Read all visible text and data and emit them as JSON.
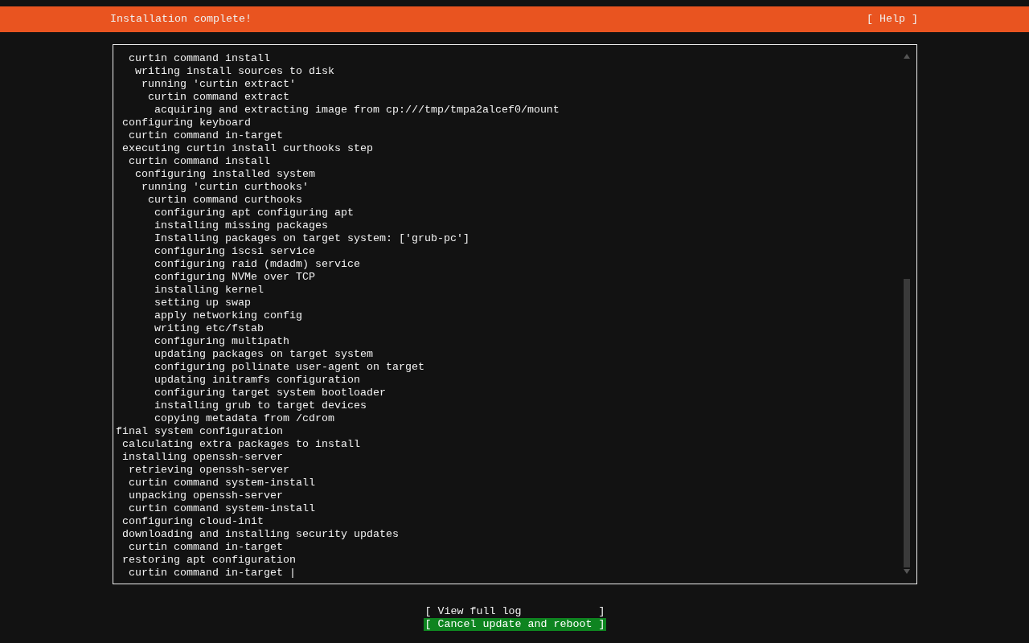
{
  "header": {
    "title": "Installation complete!",
    "help_button": "[ Help ]"
  },
  "log": [
    {
      "children": [
        {
          "children": [
            {
              "text": "curtin command install",
              "children": [
                {
                  "text": "writing install sources to disk",
                  "children": [
                    {
                      "text": "running 'curtin extract'",
                      "children": [
                        {
                          "text": "curtin command extract",
                          "children": [
                            {
                              "text": "acquiring and extracting image from cp:///tmp/tmpa2alcef0/mount"
                            }
                          ]
                        }
                      ]
                    }
                  ]
                }
              ]
            }
          ]
        },
        {
          "text": "configuring keyboard",
          "children": [
            {
              "text": "curtin command in-target"
            }
          ]
        },
        {
          "text": "executing curtin install curthooks step",
          "children": [
            {
              "text": "curtin command install",
              "children": [
                {
                  "text": "configuring installed system",
                  "children": [
                    {
                      "text": "running 'curtin curthooks'",
                      "children": [
                        {
                          "text": "curtin command curthooks",
                          "children": [
                            {
                              "text": "configuring apt configuring apt"
                            },
                            {
                              "text": "installing missing packages"
                            },
                            {
                              "text": "Installing packages on target system: ['grub-pc']"
                            },
                            {
                              "text": "configuring iscsi service"
                            },
                            {
                              "text": "configuring raid (mdadm) service"
                            },
                            {
                              "text": "configuring NVMe over TCP"
                            },
                            {
                              "text": "installing kernel"
                            },
                            {
                              "text": "setting up swap"
                            },
                            {
                              "text": "apply networking config"
                            },
                            {
                              "text": "writing etc/fstab"
                            },
                            {
                              "text": "configuring multipath"
                            },
                            {
                              "text": "updating packages on target system"
                            },
                            {
                              "text": "configuring pollinate user-agent on target"
                            },
                            {
                              "text": "updating initramfs configuration"
                            },
                            {
                              "text": "configuring target system bootloader"
                            },
                            {
                              "text": "installing grub to target devices"
                            },
                            {
                              "text": "copying metadata from /cdrom"
                            }
                          ]
                        }
                      ]
                    }
                  ]
                }
              ]
            }
          ]
        }
      ]
    },
    {
      "text": "final system configuration",
      "children": [
        {
          "text": "calculating extra packages to install"
        },
        {
          "text": "installing openssh-server",
          "children": [
            {
              "text": "retrieving openssh-server"
            },
            {
              "text": "curtin command system-install"
            },
            {
              "text": "unpacking openssh-server"
            },
            {
              "text": "curtin command system-install"
            }
          ]
        },
        {
          "text": "configuring cloud-init"
        },
        {
          "text": "downloading and installing security updates",
          "children": [
            {
              "text": "curtin command in-target"
            }
          ]
        },
        {
          "text": "restoring apt configuration",
          "children": [
            {
              "text": "curtin command in-target |"
            }
          ]
        }
      ]
    }
  ],
  "buttons": [
    {
      "label": "[ View full log            ]",
      "selected": false
    },
    {
      "label": "[ Cancel update and reboot ]",
      "selected": true
    }
  ]
}
